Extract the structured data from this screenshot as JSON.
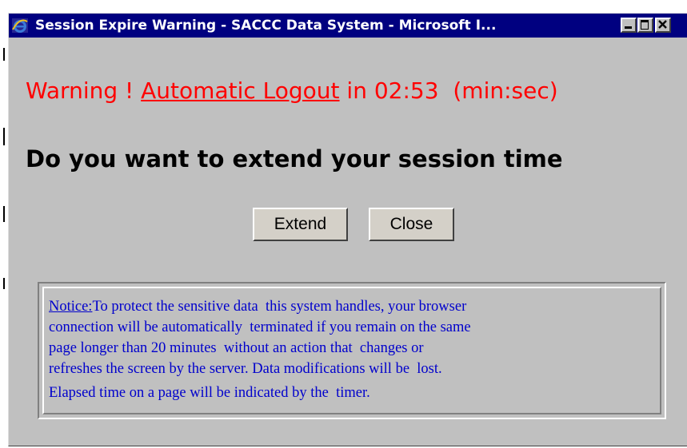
{
  "window": {
    "title": "Session Expire Warning - SACCC Data System - Microsoft I...",
    "controls": [
      "minimize-icon",
      "maximize-icon",
      "close-icon"
    ]
  },
  "warning": {
    "prefix": "Warning ! ",
    "link_text": "Automatic Logout",
    "middle": " in ",
    "time_remaining": "02:53",
    "units": "  (min:sec)"
  },
  "prompt": {
    "question": "Do you want to extend your session time"
  },
  "buttons": {
    "extend_label": "Extend",
    "close_label": "Close"
  },
  "notice": {
    "label": "Notice:",
    "body_lines": [
      "To protect the sensitive data  this system handles, your browser",
      "connection will be automatically  terminated if you remain on the same",
      "page longer than 20 minutes  without an action that  changes or",
      "refreshes the screen by the server. Data modifications will be  lost."
    ],
    "footer": "Elapsed time on a page will be indicated by the  timer."
  },
  "colors": {
    "titlebar": "#000080",
    "warning_text": "#ff0000",
    "notice_text": "#0000cc",
    "window_bg": "#c0c0c0"
  }
}
